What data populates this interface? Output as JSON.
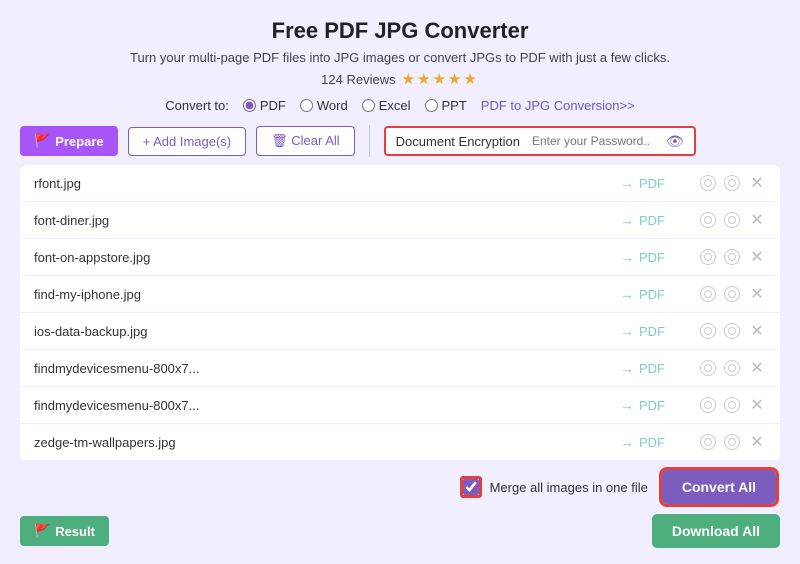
{
  "header": {
    "title": "Free PDF JPG Converter",
    "subtitle": "Turn your multi-page PDF files into JPG images or convert JPGs to PDF with just a few clicks.",
    "reviews_text": "124 Reviews",
    "stars": "★★★★★"
  },
  "convert_to": {
    "label": "Convert to:",
    "options": [
      "PDF",
      "Word",
      "Excel",
      "PPT"
    ],
    "selected": "PDF",
    "link_text": "PDF to JPG Conversion>>"
  },
  "toolbar": {
    "prepare_label": "Prepare",
    "add_image_label": "+ Add Image(s)",
    "clear_all_label": "🗑 Clear All",
    "encryption_label": "Document Encryption",
    "encryption_placeholder": "Enter your Password.."
  },
  "files": [
    {
      "name": "rfont.jpg",
      "target": "PDF"
    },
    {
      "name": "font-diner.jpg",
      "target": "PDF"
    },
    {
      "name": "font-on-appstore.jpg",
      "target": "PDF"
    },
    {
      "name": "find-my-iphone.jpg",
      "target": "PDF"
    },
    {
      "name": "ios-data-backup.jpg",
      "target": "PDF"
    },
    {
      "name": "findmydevicesmenu-800x7...",
      "target": "PDF"
    },
    {
      "name": "findmydevicesmenu-800x7...",
      "target": "PDF"
    },
    {
      "name": "zedge-tm-wallpapers.jpg",
      "target": "PDF"
    }
  ],
  "bottom": {
    "merge_label": "Merge all images in one file",
    "convert_all_label": "Convert All",
    "download_all_label": "Download All"
  },
  "result": {
    "label": "Result"
  }
}
